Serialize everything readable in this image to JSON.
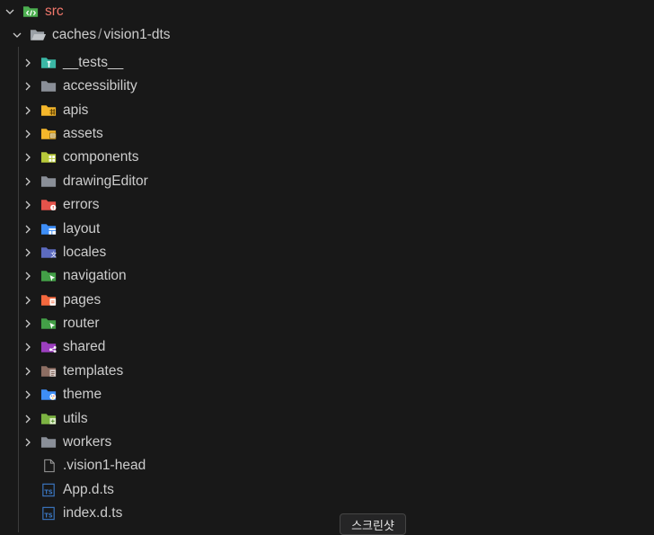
{
  "explorer": {
    "root": {
      "label": "src",
      "icon": "folder-src-open-icon"
    },
    "compact_folder": {
      "part1": "caches",
      "separator": "/",
      "part2": "vision1-dts",
      "icon": "folder-open-icon"
    },
    "items": [
      {
        "label": "__tests__",
        "kind": "folder",
        "icon": "folder-test-icon",
        "color": "#3ab7a5"
      },
      {
        "label": "accessibility",
        "kind": "folder",
        "icon": "folder-icon",
        "color": "#8a8f98"
      },
      {
        "label": "apis",
        "kind": "folder",
        "icon": "folder-api-icon",
        "color": "#f5b72b"
      },
      {
        "label": "assets",
        "kind": "folder",
        "icon": "folder-assets-icon",
        "color": "#f5b72b"
      },
      {
        "label": "components",
        "kind": "folder",
        "icon": "folder-components-icon",
        "color": "#b7c93a"
      },
      {
        "label": "drawingEditor",
        "kind": "folder",
        "icon": "folder-icon",
        "color": "#8a8f98"
      },
      {
        "label": "errors",
        "kind": "folder",
        "icon": "folder-error-icon",
        "color": "#e5534b"
      },
      {
        "label": "layout",
        "kind": "folder",
        "icon": "folder-layout-icon",
        "color": "#3e8ef7"
      },
      {
        "label": "locales",
        "kind": "folder",
        "icon": "folder-i18n-icon",
        "color": "#5c6bc0"
      },
      {
        "label": "navigation",
        "kind": "folder",
        "icon": "folder-navigation-icon",
        "color": "#43a047"
      },
      {
        "label": "pages",
        "kind": "folder",
        "icon": "folder-pages-icon",
        "color": "#f4683e"
      },
      {
        "label": "router",
        "kind": "folder",
        "icon": "folder-router-icon",
        "color": "#43a047"
      },
      {
        "label": "shared",
        "kind": "folder",
        "icon": "folder-shared-icon",
        "color": "#9c3fbf"
      },
      {
        "label": "templates",
        "kind": "folder",
        "icon": "folder-template-icon",
        "color": "#8d6e63"
      },
      {
        "label": "theme",
        "kind": "folder",
        "icon": "folder-theme-icon",
        "color": "#3e8ef7"
      },
      {
        "label": "utils",
        "kind": "folder",
        "icon": "folder-utils-icon",
        "color": "#7cb342"
      },
      {
        "label": "workers",
        "kind": "folder",
        "icon": "folder-icon",
        "color": "#8a8f98"
      },
      {
        "label": ".vision1-head",
        "kind": "file",
        "icon": "file-icon",
        "color": "#9a9a9a"
      },
      {
        "label": "App.d.ts",
        "kind": "file",
        "icon": "typescript-def-icon",
        "color": "#3b78c4"
      },
      {
        "label": "index.d.ts",
        "kind": "file",
        "icon": "typescript-def-icon",
        "color": "#3b78c4"
      }
    ]
  },
  "tooltip": {
    "text": "스크린샷"
  }
}
